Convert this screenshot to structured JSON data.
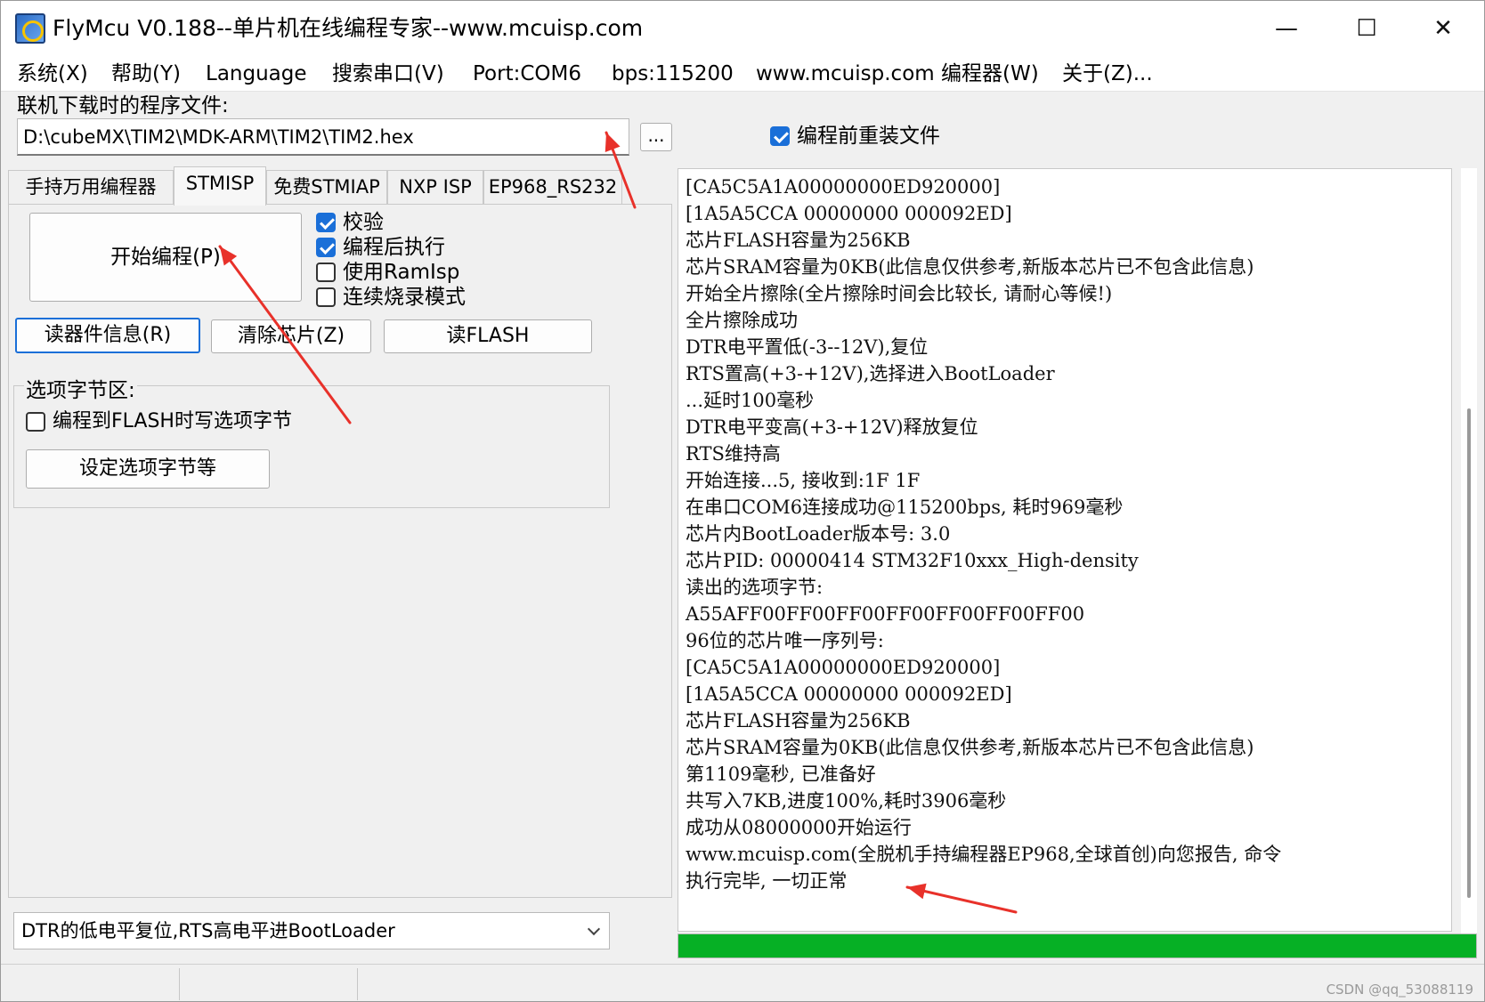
{
  "window": {
    "title": "FlyMcu V0.188--单片机在线编程专家--www.mcuisp.com",
    "minimize": "—",
    "maximize": "☐",
    "close": "✕"
  },
  "menu": [
    "系统(X)",
    "帮助(Y)",
    "Language",
    "搜索串口(V)",
    "Port:COM6",
    "bps:115200",
    "www.mcuisp.com 编程器(W)",
    "关于(Z)..."
  ],
  "file": {
    "label": "联机下载时的程序文件:",
    "path": "D:\\cubeMX\\TIM2\\MDK-ARM\\TIM2\\TIM2.hex",
    "browse": "...",
    "reload_label": "编程前重装文件",
    "reload_checked": true
  },
  "tabs": [
    "手持万用编程器",
    "STMISP",
    "免费STMIAP",
    "NXP ISP",
    "EP968_RS232"
  ],
  "stmisp": {
    "start_button": "开始编程(P)",
    "options": [
      {
        "label": "校验",
        "checked": true
      },
      {
        "label": "编程后执行",
        "checked": true
      },
      {
        "label": "使用RamIsp",
        "checked": false
      },
      {
        "label": "连续烧录模式",
        "checked": false
      }
    ],
    "read_info_button": "读器件信息(R)",
    "erase_button": "清除芯片(Z)",
    "read_flash_button": "读FLASH",
    "option_group_title": "选项字节区:",
    "write_option_label": "编程到FLASH时写选项字节",
    "write_option_checked": false,
    "set_option_button": "设定选项字节等"
  },
  "reset_mode": "DTR的低电平复位,RTS高电平进BootLoader",
  "log": [
    "[CA5C5A1A00000000ED920000]",
    "[1A5A5CCA 00000000 000092ED]",
    "芯片FLASH容量为256KB",
    "芯片SRAM容量为0KB(此信息仅供参考,新版本芯片已不包含此信息)",
    "开始全片擦除(全片擦除时间会比较长, 请耐心等候!)",
    "全片擦除成功",
    "DTR电平置低(-3--12V),复位",
    "RTS置高(+3-+12V),选择进入BootLoader",
    "...延时100毫秒",
    "DTR电平变高(+3-+12V)释放复位",
    "RTS维持高",
    "开始连接...5, 接收到:1F 1F",
    "在串口COM6连接成功@115200bps, 耗时969毫秒",
    "芯片内BootLoader版本号: 3.0",
    "芯片PID: 00000414  STM32F10xxx_High-density",
    "读出的选项字节:",
    "A55AFF00FF00FF00FF00FF00FF00FF00",
    "96位的芯片唯一序列号:",
    "[CA5C5A1A00000000ED920000]",
    "[1A5A5CCA 00000000 000092ED]",
    "芯片FLASH容量为256KB",
    "芯片SRAM容量为0KB(此信息仅供参考,新版本芯片已不包含此信息)",
    "第1109毫秒, 已准备好",
    "共写入7KB,进度100%,耗时3906毫秒",
    "成功从08000000开始运行",
    "www.mcuisp.com(全脱机手持编程器EP968,全球首创)向您报告, 命令",
    "执行完毕, 一切正常"
  ],
  "progress": 1.0,
  "colors": {
    "progress": "#06b025",
    "annotation": "#e8312a",
    "accent": "#1a6fd8"
  },
  "watermark": "CSDN @qq_53088119"
}
